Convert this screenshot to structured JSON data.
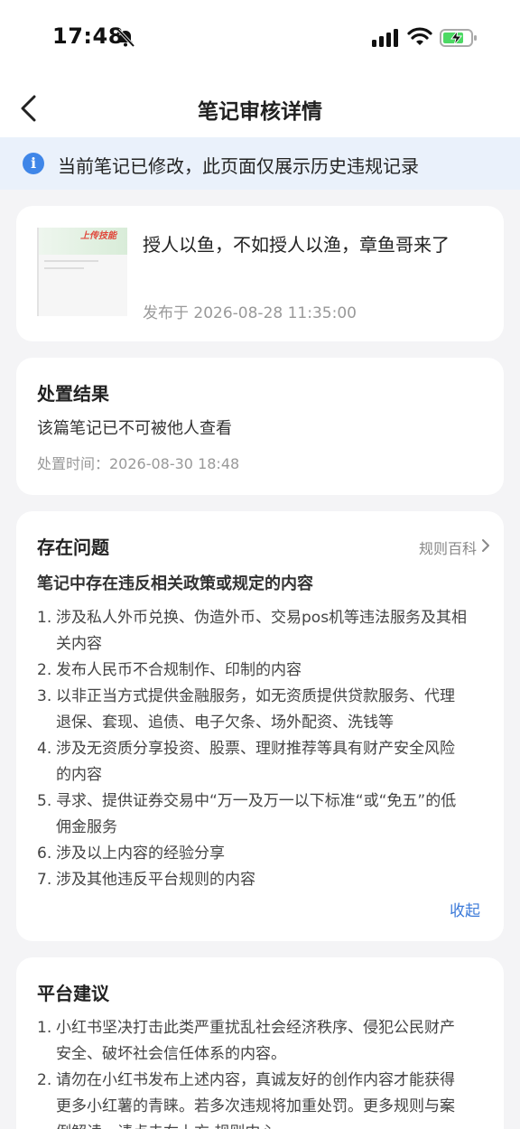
{
  "status_bar": {
    "time": "17:48",
    "icons": [
      "bell-slash-icon",
      "signal-icon",
      "wifi-icon",
      "battery-charging-icon"
    ]
  },
  "nav": {
    "title": "笔记审核详情",
    "back_icon": "chevron-left-icon"
  },
  "notice": {
    "icon": "info-icon",
    "text": "当前笔记已修改，此页面仅展示历史违规记录"
  },
  "note": {
    "thumbnail_label": "上传技能",
    "title": "授人以鱼，不如授人以渔，章鱼哥来了",
    "published": "发布于 2026-08-28 11:35:00"
  },
  "result": {
    "title": "处置结果",
    "text": "该篇笔记已不可被他人查看",
    "time": "处置时间：2026-08-30 18:48"
  },
  "issues": {
    "title": "存在问题",
    "rules_link": "规则百科",
    "subtitle": "笔记中存在违反相关政策或规定的内容",
    "items": [
      {
        "num": "1.",
        "lines": [
          "涉及私人外币兑换、伪造外币、交易pos机等违法服务及其相",
          "关内容"
        ]
      },
      {
        "num": "2.",
        "lines": [
          "发布人民币不合规制作、印制的内容"
        ]
      },
      {
        "num": "3.",
        "lines": [
          "以非正当方式提供金融服务，如无资质提供贷款服务、代理",
          "退保、套现、追债、电子欠条、场外配资、洗钱等"
        ]
      },
      {
        "num": "4.",
        "lines": [
          "涉及无资质分享投资、股票、理财推荐等具有财产安全风险",
          "的内容"
        ]
      },
      {
        "num": "5.",
        "lines": [
          "寻求、提供证券交易中“万一及万一以下标准“或“免五”的低",
          "佣金服务"
        ]
      },
      {
        "num": "6.",
        "lines": [
          "涉及以上内容的经验分享"
        ]
      },
      {
        "num": "7.",
        "lines": [
          "涉及其他违反平台规则的内容"
        ]
      }
    ],
    "collapse": "收起"
  },
  "advice": {
    "title": "平台建议",
    "items": [
      {
        "num": "1.",
        "lines": [
          "小红书坚决打击此类严重扰乱社会经济秩序、侵犯公民财产",
          "安全、破坏社会信任体系的内容。"
        ]
      },
      {
        "num": "2.",
        "lines": [
          "请勿在小红书发布上述内容，真诚友好的创作内容才能获得",
          "更多小红薯的青睐。若多次违规将加重处罚。更多规则与案",
          "例解读，请点击右上方 规则中心"
        ]
      }
    ]
  },
  "colors": {
    "accent": "#3b7ad9",
    "banner_bg": "#eaf1fb",
    "page_bg": "#f4f4f6"
  }
}
